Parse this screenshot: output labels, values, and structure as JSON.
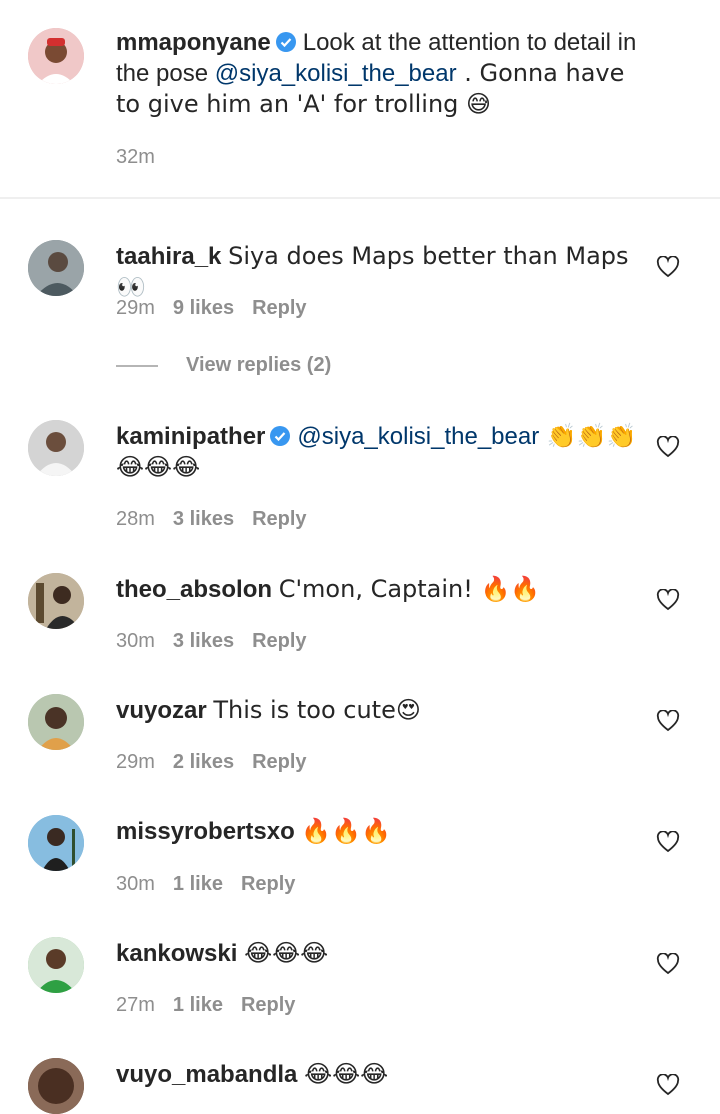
{
  "caption": {
    "username": "mmaponyane",
    "text_part1": "Look at the attention to detail in the pose ",
    "mention": "@siya_kolisi_the_bear",
    "text_part2": " . Gonna have to give him an 'A' for trolling 😅",
    "time": "32m"
  },
  "comments": [
    {
      "username": "taahira_k",
      "text": "Siya does Maps better than Maps 👀",
      "time": "29m",
      "likes": "9 likes",
      "reply": "Reply",
      "view_replies": "View replies (2)"
    },
    {
      "username": "kaminipather",
      "mention": "@siya_kolisi_the_bear",
      "text": " 👏👏👏😂😂😂",
      "time": "28m",
      "likes": "3 likes",
      "reply": "Reply"
    },
    {
      "username": "theo_absolon",
      "text": "C'mon, Captain! 🔥🔥",
      "time": "30m",
      "likes": "3 likes",
      "reply": "Reply"
    },
    {
      "username": "vuyozar",
      "text": "This is too cute😍",
      "time": "29m",
      "likes": "2 likes",
      "reply": "Reply"
    },
    {
      "username": "missyrobertsxo",
      "text": "🔥🔥🔥",
      "time": "30m",
      "likes": "1 like",
      "reply": "Reply"
    },
    {
      "username": "kankowski",
      "text": "😂😂😂",
      "time": "27m",
      "likes": "1 like",
      "reply": "Reply"
    },
    {
      "username": "vuyo_mabandla",
      "text": "😂😂😂"
    }
  ],
  "colors": {
    "mention": "#00376b",
    "meta": "#8e8e8e",
    "verified": "#3897f0"
  },
  "icons": [
    "verified-icon",
    "heart-icon"
  ]
}
